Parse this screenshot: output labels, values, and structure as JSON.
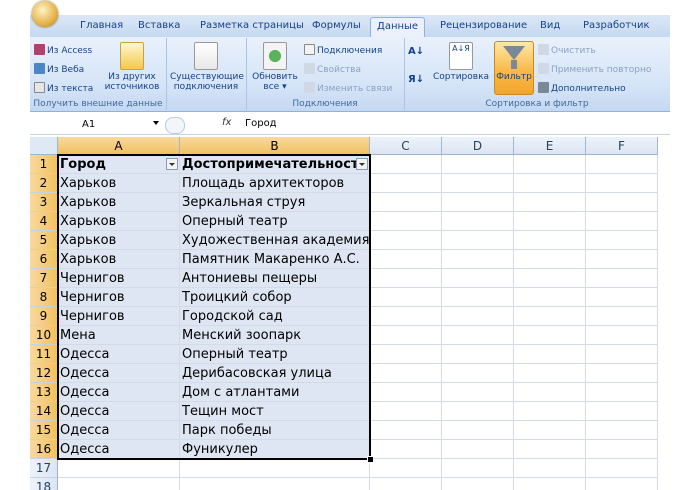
{
  "ribbon": {
    "tabs": [
      "Главная",
      "Вставка",
      "Разметка страницы",
      "Формулы",
      "Данные",
      "Рецензирование",
      "Вид",
      "Разработчик"
    ],
    "active_tab": "Данные",
    "external": {
      "from_access": "Из Access",
      "from_web": "Из Веба",
      "from_text": "Из текста",
      "other_sources_1": "Из других",
      "other_sources_2": "источников",
      "group_label": "Получить внешние данные"
    },
    "existing": {
      "line1": "Существующие",
      "line2": "подключения"
    },
    "connections": {
      "refresh_1": "Обновить",
      "refresh_2": "все",
      "connections": "Подключения",
      "properties": "Свойства",
      "edit_links": "Изменить связи",
      "group_label": "Подключения"
    },
    "sort_filter": {
      "sort_az": "А↓Я",
      "sort": "Сортировка",
      "filter": "Фильтр",
      "clear": "Очистить",
      "reapply": "Применить повторно",
      "advanced": "Дополнительно",
      "group_label": "Сортировка и фильтр"
    }
  },
  "formula_bar": {
    "name_box": "A1",
    "fx": "fx",
    "value": "Город"
  },
  "columns": [
    "A",
    "B",
    "C",
    "D",
    "E",
    "F"
  ],
  "selected_columns": [
    "A",
    "B"
  ],
  "rows": [
    {
      "n": "1",
      "a": "Город",
      "b": "Достопримечательность"
    },
    {
      "n": "2",
      "a": "Харьков",
      "b": "Площадь архитекторов"
    },
    {
      "n": "3",
      "a": "Харьков",
      "b": "Зеркальная струя"
    },
    {
      "n": "4",
      "a": "Харьков",
      "b": "Оперный театр"
    },
    {
      "n": "5",
      "a": "Харьков",
      "b": "Художественная академия"
    },
    {
      "n": "6",
      "a": "Харьков",
      "b": "Памятник Макаренко А.С."
    },
    {
      "n": "7",
      "a": "Чернигов",
      "b": "Антониевы пещеры"
    },
    {
      "n": "8",
      "a": "Чернигов",
      "b": "Троицкий собор"
    },
    {
      "n": "9",
      "a": "Чернигов",
      "b": "Городской сад"
    },
    {
      "n": "10",
      "a": "Мена",
      "b": "Менский зоопарк"
    },
    {
      "n": "11",
      "a": "Одесса",
      "b": "Оперный театр"
    },
    {
      "n": "12",
      "a": "Одесса",
      "b": "Дерибасовская улица"
    },
    {
      "n": "13",
      "a": "Одесса",
      "b": "Дом с атлантами"
    },
    {
      "n": "14",
      "a": "Одесса",
      "b": "Тещин мост"
    },
    {
      "n": "15",
      "a": "Одесса",
      "b": "Парк победы"
    },
    {
      "n": "16",
      "a": "Одесса",
      "b": "Фуникулер"
    },
    {
      "n": "17",
      "a": "",
      "b": ""
    },
    {
      "n": "18",
      "a": "",
      "b": ""
    }
  ],
  "colors": {
    "accent": "#f4a52b",
    "table_fill": "#dfe6f3",
    "header_blue": "#15428b"
  }
}
